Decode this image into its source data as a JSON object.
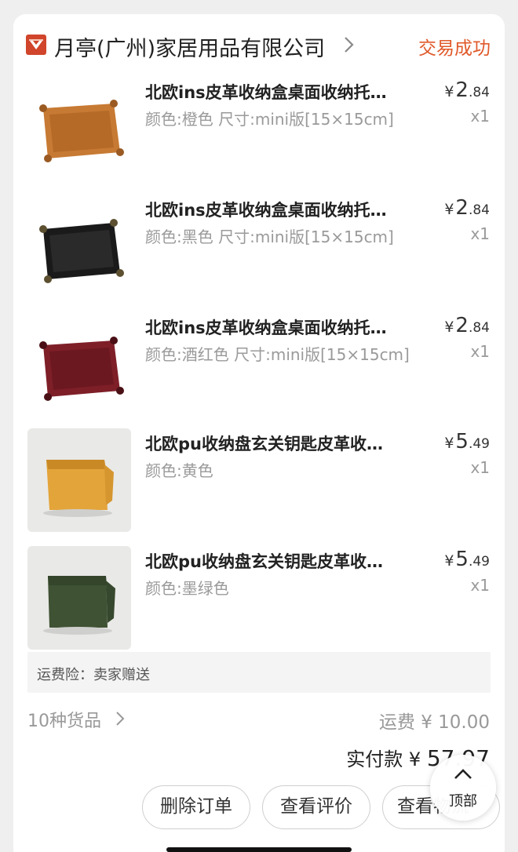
{
  "shop": {
    "name": "月亭(广州)家居用品有限公司",
    "status": "交易成功"
  },
  "items": [
    {
      "title": "北欧ins皮革收纳盒桌面收纳托…",
      "spec": "颜色:橙色 尺寸:mini版[15×15cm]",
      "currency": "¥",
      "price_int": "2",
      "price_dec": ".84",
      "qty": "x1",
      "color": "#c77a33"
    },
    {
      "title": "北欧ins皮革收纳盒桌面收纳托…",
      "spec": "颜色:黑色 尺寸:mini版[15×15cm]",
      "currency": "¥",
      "price_int": "2",
      "price_dec": ".84",
      "qty": "x1",
      "color": "#1a1a1a"
    },
    {
      "title": "北欧ins皮革收纳盒桌面收纳托…",
      "spec": "颜色:酒红色 尺寸:mini版[15×15cm]",
      "currency": "¥",
      "price_int": "2",
      "price_dec": ".84",
      "qty": "x1",
      "color": "#7e1f28"
    },
    {
      "title": "北欧pu收纳盘玄关钥匙皮革收…",
      "spec": "颜色:黄色",
      "currency": "¥",
      "price_int": "5",
      "price_dec": ".49",
      "qty": "x1",
      "color": "#e3a43a"
    },
    {
      "title": "北欧pu收纳盘玄关钥匙皮革收…",
      "spec": "颜色:墨绿色",
      "currency": "¥",
      "price_int": "5",
      "price_dec": ".49",
      "qty": "x1",
      "color": "#3f5234"
    }
  ],
  "insurance": "运费险：卖家赠送",
  "summary": {
    "goods_count": "10种货品",
    "shipping": "运费 ¥ 10.00",
    "paid_label": "实付款 ¥ ",
    "paid_amount": "57.97"
  },
  "buttons": {
    "delete": "删除订单",
    "review": "查看评价",
    "logistics": "查看物流"
  },
  "back_to_top": "顶部",
  "colors": {
    "accent": "#e0592a",
    "logo": "#d0452b"
  }
}
